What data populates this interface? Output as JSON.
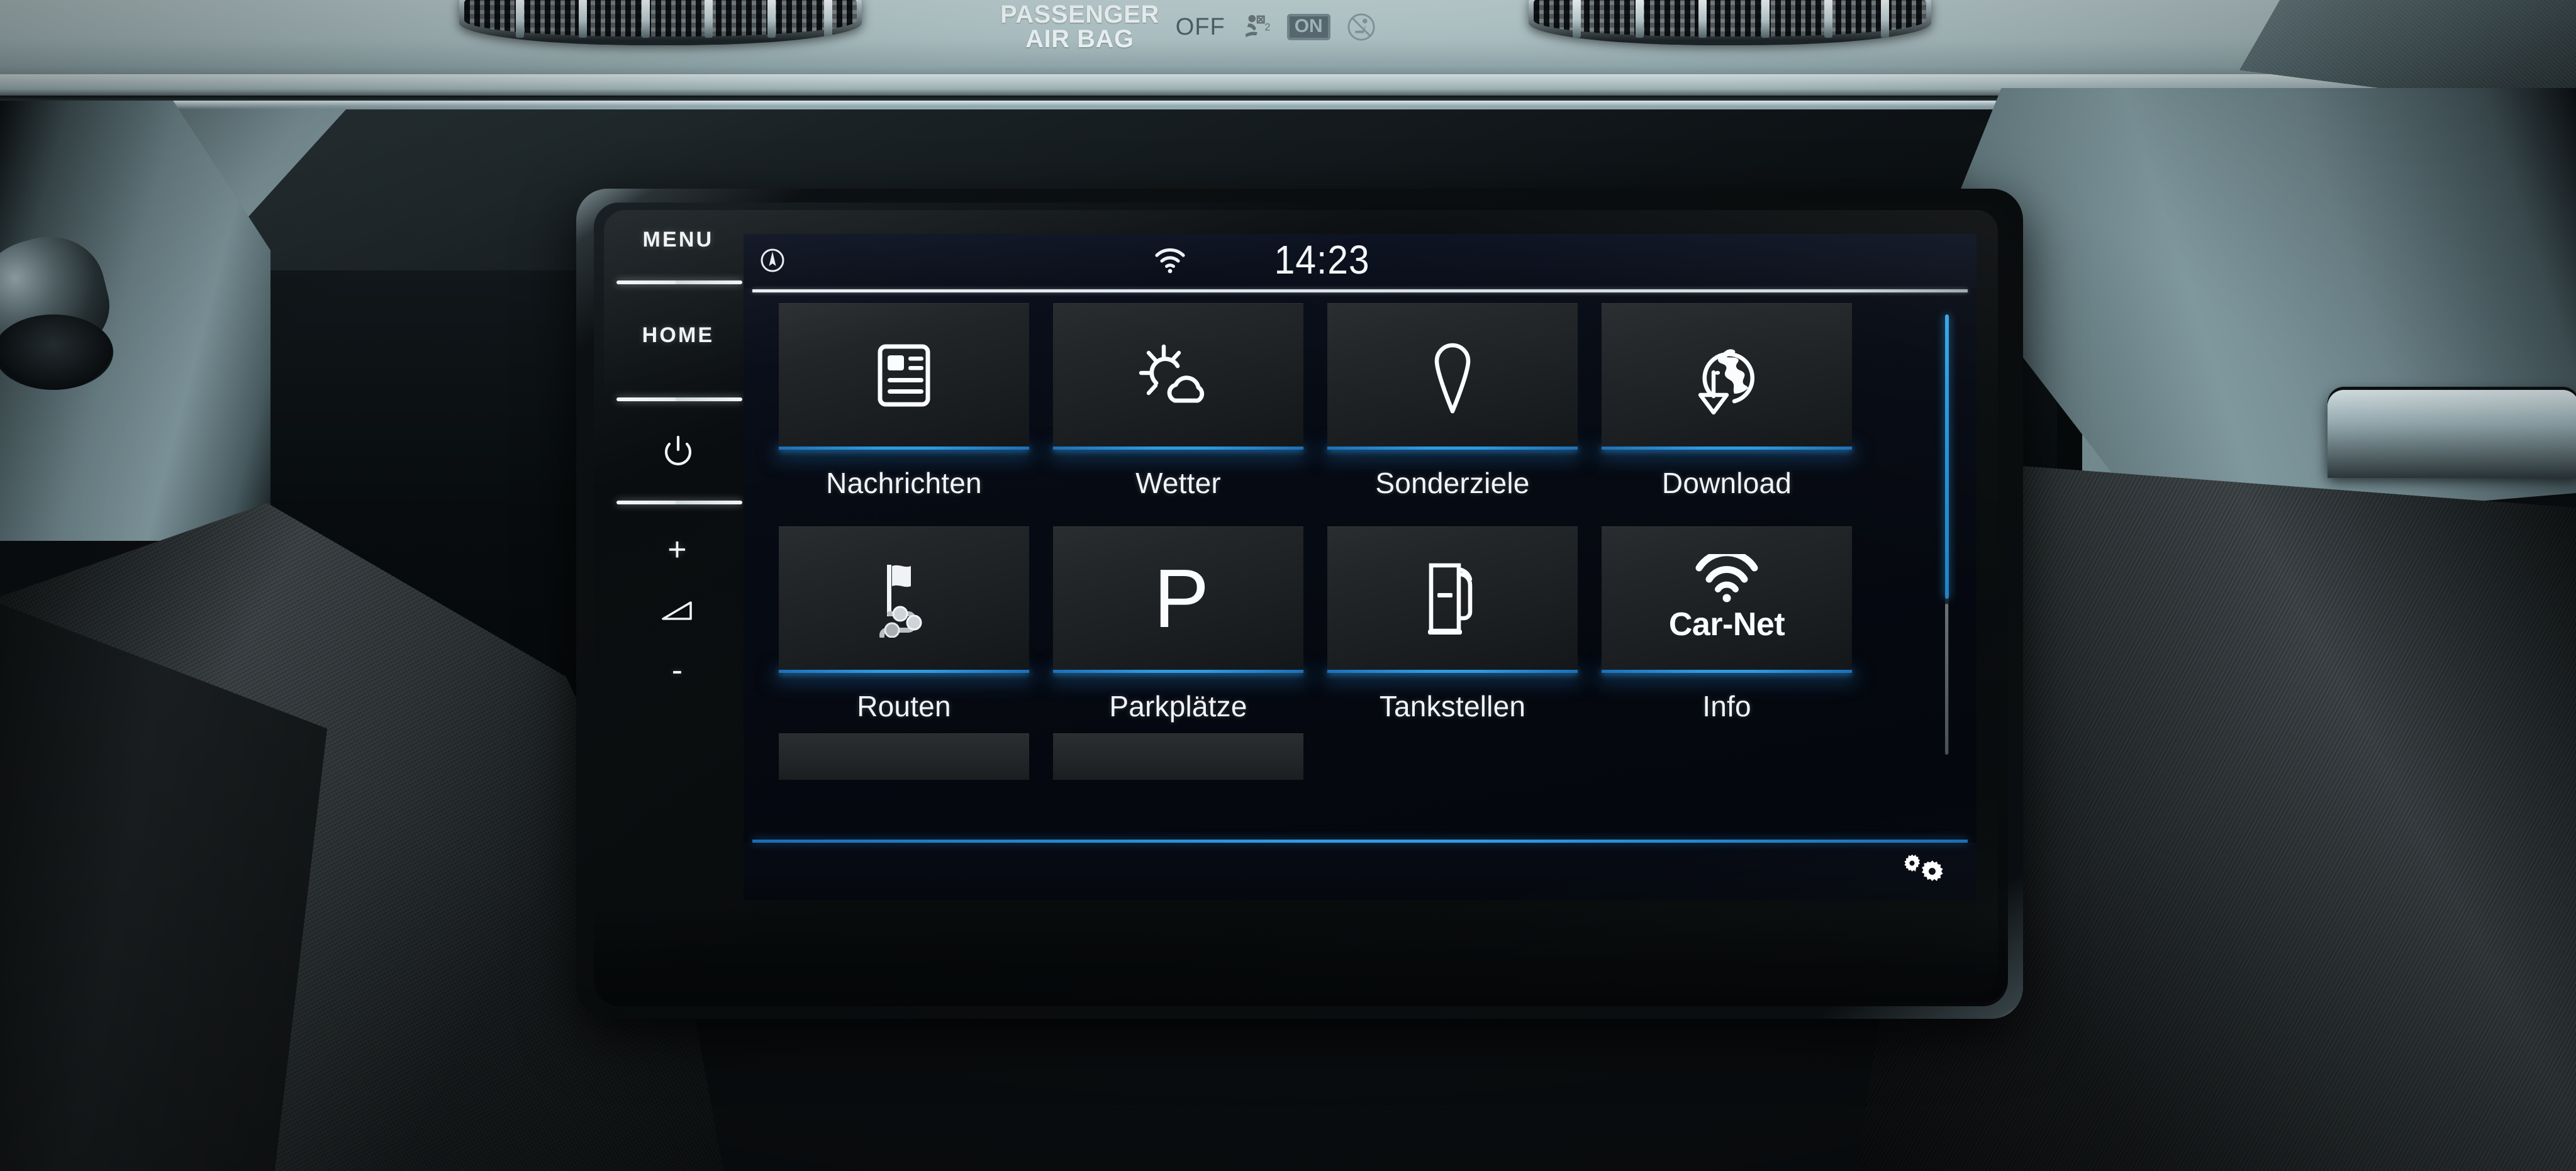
{
  "vehicle": {
    "airbag_indicator": {
      "title_line1": "PASSENGER",
      "title_line2": "AIR BAG",
      "off_label": "OFF",
      "on_label": "ON",
      "off_icon": "airbag-deploy-icon",
      "on_icon": "no-child-seat-icon"
    }
  },
  "bezel_keys": {
    "menu_label": "MENU",
    "home_label": "HOME",
    "power_icon": "power-icon",
    "volume_up_label": "+",
    "volume_icon": "volume-wedge-icon",
    "volume_down_label": "-"
  },
  "screen": {
    "statusbar": {
      "nav_icon": "compass-icon",
      "wifi_icon": "wifi-icon",
      "time": "14:23"
    },
    "menu_grid": {
      "rows": [
        [
          {
            "label": "Nachrichten",
            "icon": "news-icon"
          },
          {
            "label": "Wetter",
            "icon": "sun-cloud-icon"
          },
          {
            "label": "Sonderziele",
            "icon": "map-pin-icon"
          },
          {
            "label": "Download",
            "icon": "globe-download-icon"
          }
        ],
        [
          {
            "label": "Routen",
            "icon": "flag-route-icon"
          },
          {
            "label": "Parkplätze",
            "icon": "parking-p-icon"
          },
          {
            "label": "Tankstellen",
            "icon": "fuel-pump-icon"
          },
          {
            "label": "Info",
            "icon": "car-net-wifi-icon",
            "icon_text": "Car-Net"
          }
        ]
      ],
      "third_row_partial": true
    },
    "scrollbar": {
      "orientation": "vertical",
      "thumb_fraction": 0.65,
      "thumb_position": "top"
    },
    "bottom_bar": {
      "settings_icon": "gears-icon"
    }
  },
  "colors": {
    "accent_blue": "#2e9adf",
    "accent_blue_dark": "#1d6fb8",
    "screen_bg": "#05080f",
    "tile_bg": "#232629",
    "text_primary": "#f2f5f8",
    "dash_teal": "#8fa7ad",
    "scrollbar_rest": "#6d7277"
  }
}
